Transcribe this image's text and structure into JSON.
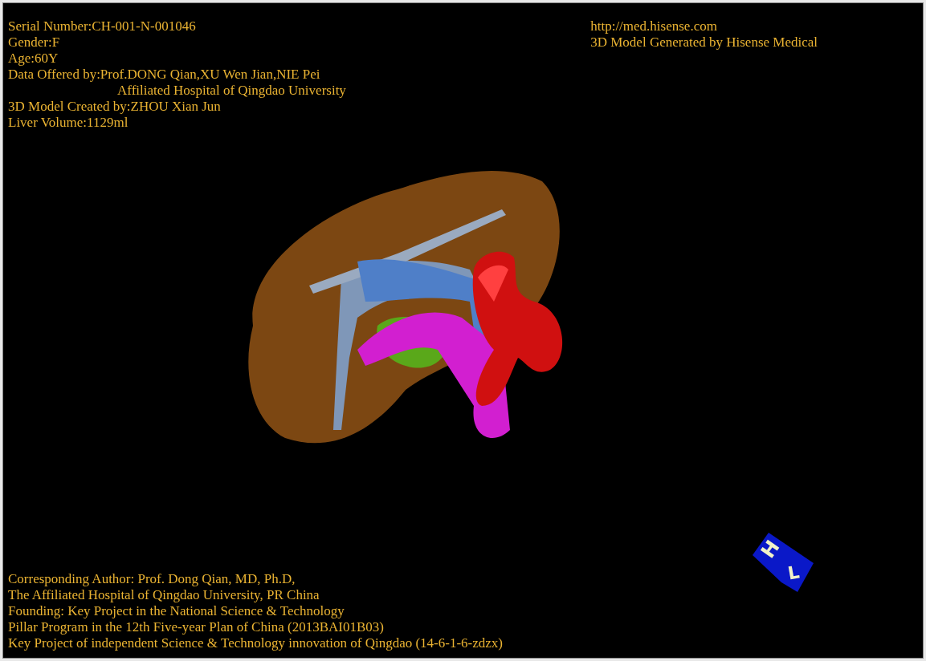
{
  "header_left": [
    "Serial Number:CH-001-N-001046",
    "Gender:F",
    "Age:60Y",
    "Data Offered by:Prof.DONG Qian,XU Wen Jian,NIE Pei",
    "Affiliated Hospital of Qingdao University",
    "3D Model Created by:ZHOU Xian Jun",
    "Liver Volume:1129ml"
  ],
  "header_right": [
    "http://med.hisense.com",
    "3D Model Generated by Hisense Medical"
  ],
  "footer": [
    "Corresponding Author: Prof. Dong Qian, MD, Ph.D,",
    "The Affiliated Hospital of Qingdao University, PR China",
    "Founding: Key Project in the National Science & Technology",
    "Pillar Program in the 12th Five-year Plan of China (2013BAI01B03)",
    "Key Project of independent Science & Technology innovation of Qingdao (14-6-1-6-zdzx)"
  ],
  "orientation_cube": {
    "labels": [
      "H",
      "L"
    ]
  }
}
